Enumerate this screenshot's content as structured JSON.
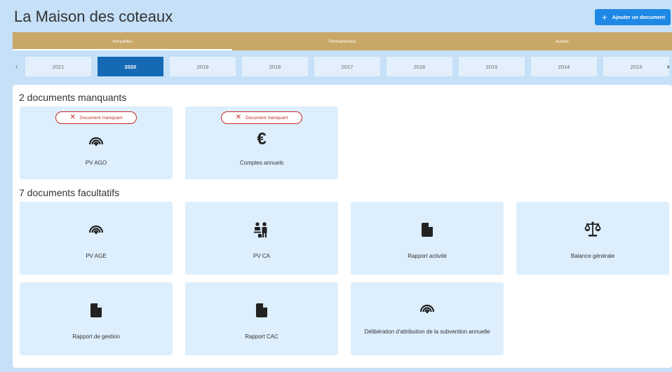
{
  "header": {
    "title": "La Maison des coteaux",
    "add_button_label": "Ajouter un document"
  },
  "tabs": [
    {
      "label": "Annuelles",
      "active": true
    },
    {
      "label": "Permanentes",
      "active": false
    },
    {
      "label": "Autres",
      "active": false
    }
  ],
  "years": {
    "items": [
      "2021",
      "2020",
      "2019",
      "2018",
      "2017",
      "2016",
      "2015",
      "2014",
      "2013"
    ],
    "selected": "2020",
    "prev_glyph": "‹",
    "next_glyph": "›"
  },
  "missing": {
    "title": "2 documents manquants",
    "badge_label": "Document manquant",
    "cards": [
      {
        "label": "PV AGO",
        "icon": "signal-icon"
      },
      {
        "label": "Comptes annuels",
        "icon": "euro-icon"
      }
    ]
  },
  "optional": {
    "title": "7 documents facultatifs",
    "cards": [
      {
        "label": "PV AGE",
        "icon": "signal-icon"
      },
      {
        "label": "PV CA",
        "icon": "meeting-icon"
      },
      {
        "label": "Rapport activité",
        "icon": "document-icon"
      },
      {
        "label": "Balance générale",
        "icon": "scale-icon"
      },
      {
        "label": "Rapport de gestion",
        "icon": "document-icon"
      },
      {
        "label": "Rapport CAC",
        "icon": "document-icon"
      },
      {
        "label": "Délibération d'attribution de la subvention annuelle",
        "icon": "signal-icon"
      }
    ]
  },
  "colors": {
    "background": "#c5e0f7",
    "tab_bar": "#c9a767",
    "primary": "#1e88e5",
    "selected_year": "#1669b5",
    "card": "#ddeefc",
    "missing": "#c62828"
  }
}
